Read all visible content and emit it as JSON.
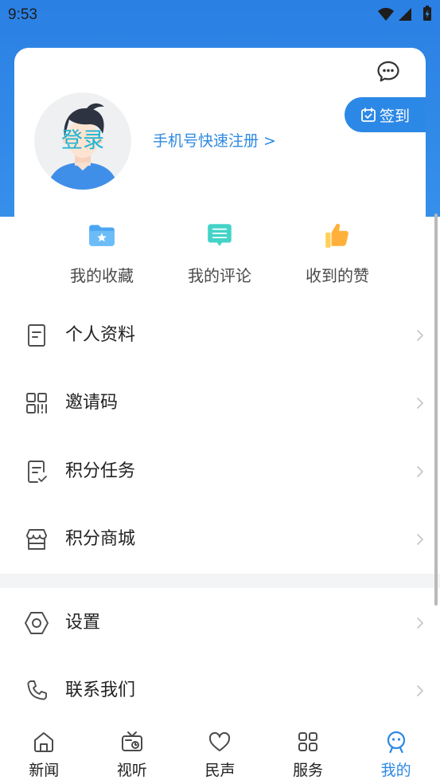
{
  "status_bar": {
    "time": "9:53",
    "icons": [
      "wifi-icon",
      "signal-icon",
      "battery-charging-icon"
    ]
  },
  "header": {
    "message_icon": "chat-bubble-icon",
    "checkin": {
      "label": "签到",
      "icon": "calendar-check-icon"
    }
  },
  "profile": {
    "avatar": "cartoon-avatar",
    "login_label": "登录",
    "register_link": "手机号快速注册 >"
  },
  "quick_actions": [
    {
      "label": "我的收藏",
      "icon": "folder-star-icon"
    },
    {
      "label": "我的评论",
      "icon": "comment-icon"
    },
    {
      "label": "收到的赞",
      "icon": "thumbs-up-icon"
    }
  ],
  "menu": {
    "group1": [
      {
        "label": "个人资料",
        "icon": "document-icon"
      },
      {
        "label": "邀请码",
        "icon": "qr-code-icon"
      },
      {
        "label": "积分任务",
        "icon": "task-check-icon"
      },
      {
        "label": "积分商城",
        "icon": "store-icon"
      }
    ],
    "group2": [
      {
        "label": "设置",
        "icon": "settings-icon"
      },
      {
        "label": "联系我们",
        "icon": "phone-icon"
      }
    ]
  },
  "bottom_nav": {
    "tabs": [
      {
        "label": "新闻",
        "icon": "home-icon",
        "active": false
      },
      {
        "label": "视听",
        "icon": "tv-icon",
        "active": false
      },
      {
        "label": "民声",
        "icon": "heart-icon",
        "active": false
      },
      {
        "label": "服务",
        "icon": "grid-icon",
        "active": false
      },
      {
        "label": "我的",
        "icon": "smiley-icon",
        "active": true
      }
    ]
  },
  "colors": {
    "primary": "#2c88e6",
    "header_gradient_top": "#2a80e3",
    "header_gradient_bottom": "#3690ea",
    "login_text": "#1fb4d4",
    "text": "#222222",
    "chevron": "#c4c4c4",
    "divider_band": "#f3f4f6"
  }
}
